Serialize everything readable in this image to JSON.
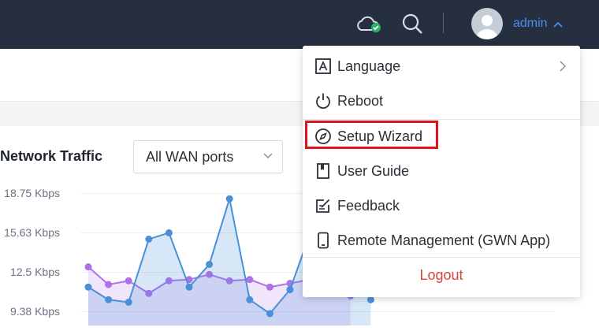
{
  "header": {
    "username": "admin"
  },
  "traffic": {
    "title": "Network Traffic",
    "port_select": "All WAN ports",
    "y_ticks": [
      "18.75 Kbps",
      "15.63 Kbps",
      "12.5 Kbps",
      "9.38 Kbps"
    ]
  },
  "user_menu": {
    "language": "Language",
    "reboot": "Reboot",
    "setup_wizard": "Setup Wizard",
    "user_guide": "User Guide",
    "feedback": "Feedback",
    "remote_management": "Remote Management (GWN App)",
    "logout": "Logout"
  },
  "chart_data": {
    "type": "area",
    "y_unit": "Kbps",
    "y_ticks": [
      18.75,
      15.63,
      12.5,
      9.38
    ],
    "series": [
      {
        "color": "#4a90d9",
        "values": [
          11.3,
          10.3,
          10.1,
          15.1,
          15.6,
          11.3,
          13.1,
          18.3,
          10.3,
          9.2,
          11.1,
          15.6,
          11.3,
          13.1,
          10.3
        ]
      },
      {
        "color": "#b070e8",
        "values": [
          12.9,
          11.5,
          11.8,
          10.8,
          11.8,
          11.9,
          12.3,
          11.8,
          11.9,
          11.3,
          11.6,
          11.9,
          12.5,
          10.6
        ]
      }
    ],
    "colors": {
      "line1": "#4a90d9",
      "line2": "#b070e8",
      "accent": "#4a8df0",
      "logout": "#d4473b",
      "highlight": "#e0121a"
    }
  }
}
